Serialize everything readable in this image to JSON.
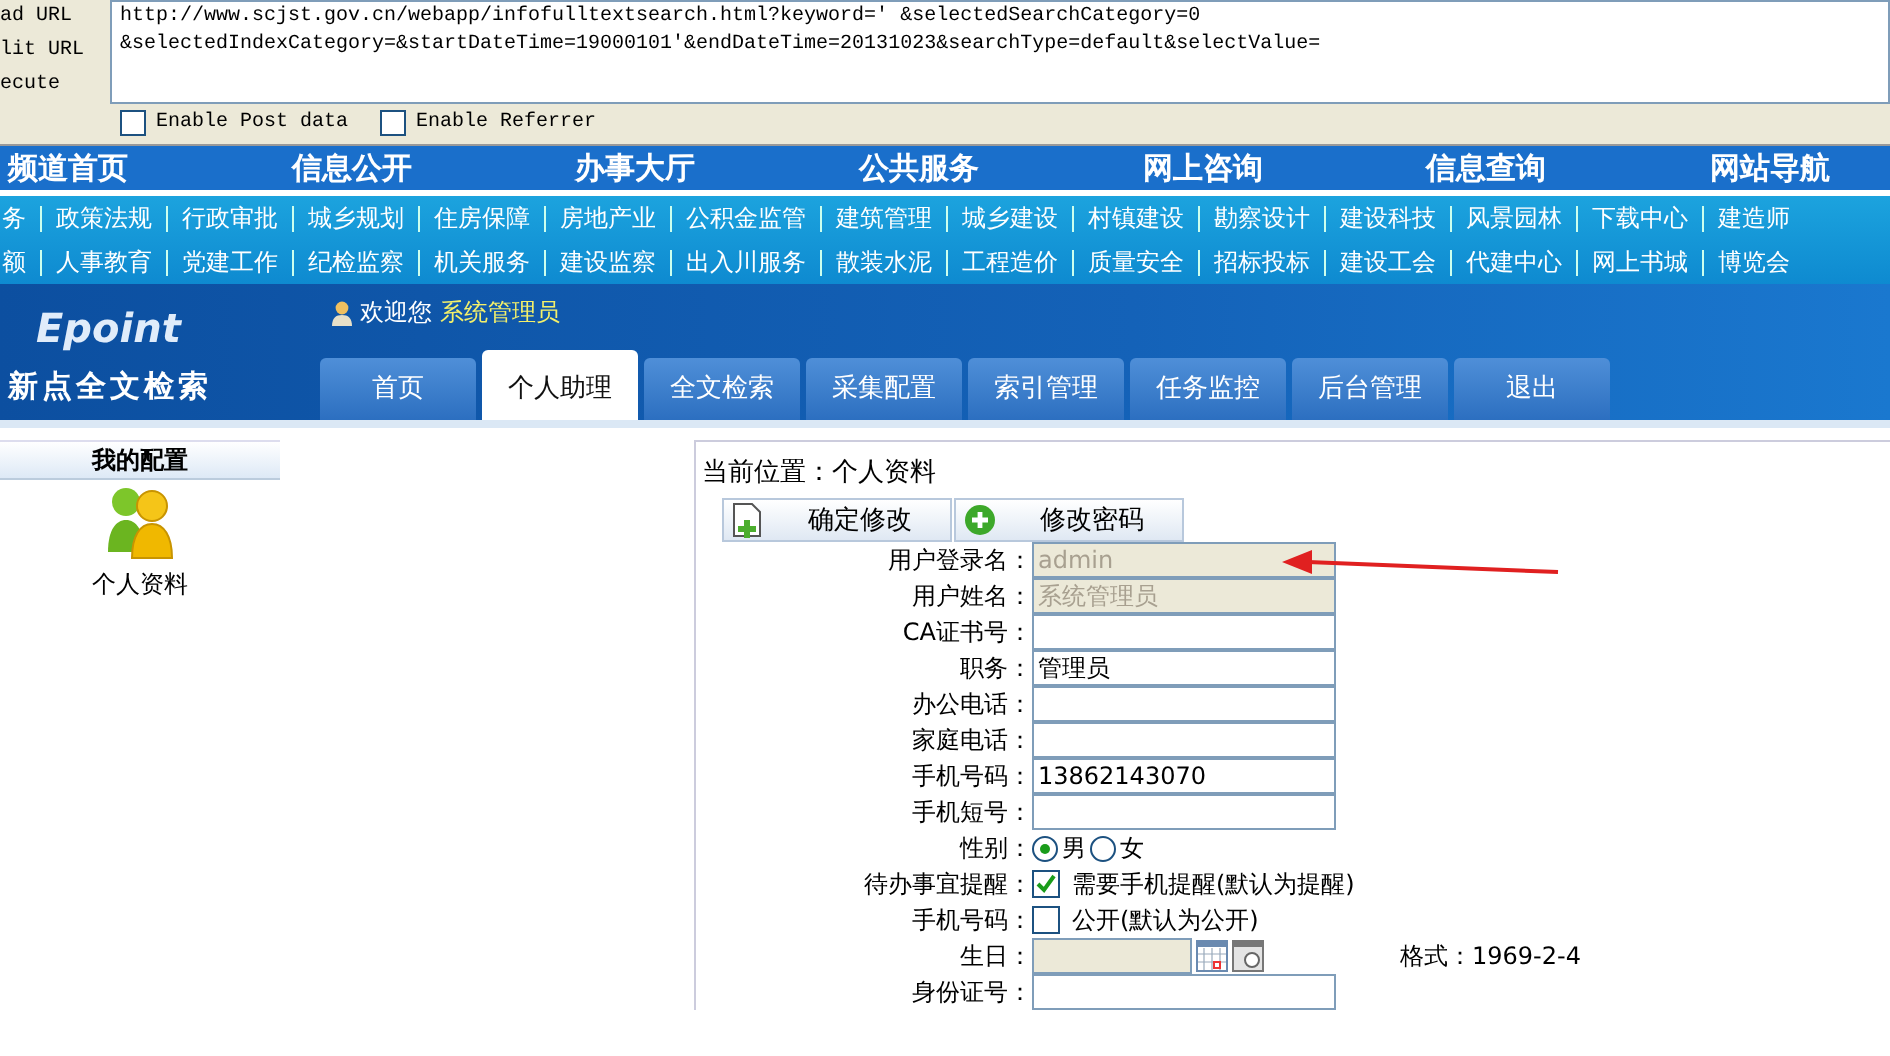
{
  "hackbar": {
    "labels": [
      "ad URL",
      "lit URL",
      "ecute"
    ],
    "url_lines": [
      "http://www.scjst.gov.cn/webapp/infofulltextsearch.html?keyword=' &selectedSearchCategory=0",
      "&selectedIndexCategory=&startDateTime=19000101'&endDateTime=20131023&searchType=default&selectValue="
    ],
    "options": [
      {
        "label": "Enable Post data",
        "checked": false
      },
      {
        "label": "Enable Referrer",
        "checked": false
      }
    ]
  },
  "main_nav": [
    "频道首页",
    "信息公开",
    "办事大厅",
    "公共服务",
    "网上咨询",
    "信息查询",
    "网站导航"
  ],
  "link_rows": [
    [
      "务",
      "政策法规",
      "行政审批",
      "城乡规划",
      "住房保障",
      "房地产业",
      "公积金监管",
      "建筑管理",
      "城乡建设",
      "村镇建设",
      "勘察设计",
      "建设科技",
      "风景园林",
      "下载中心",
      "建造师"
    ],
    [
      "额",
      "人事教育",
      "党建工作",
      "纪检监察",
      "机关服务",
      "建设监察",
      "出入川服务",
      "散装水泥",
      "工程造价",
      "质量安全",
      "招标投标",
      "建设工会",
      "代建中心",
      "网上书城",
      "博览会"
    ]
  ],
  "header": {
    "logo": "Epoint",
    "app_name": "新点全文检索",
    "welcome": "欢迎您",
    "user": "系统管理员"
  },
  "tabs": [
    {
      "label": "首页",
      "selected": false
    },
    {
      "label": "个人助理",
      "selected": true
    },
    {
      "label": "全文检索",
      "selected": false
    },
    {
      "label": "采集配置",
      "selected": false
    },
    {
      "label": "索引管理",
      "selected": false
    },
    {
      "label": "任务监控",
      "selected": false
    },
    {
      "label": "后台管理",
      "selected": false
    },
    {
      "label": "退出",
      "selected": false
    }
  ],
  "sidebar": {
    "title": "我的配置",
    "items": [
      {
        "label": "个人资料"
      }
    ]
  },
  "breadcrumb": "当前位置：个人资料",
  "buttons": [
    {
      "label": "确定修改",
      "kind": "doc"
    },
    {
      "label": "修改密码",
      "kind": "plus"
    }
  ],
  "form": [
    {
      "label": "用户登录名：",
      "kind": "text",
      "value": "admin",
      "disabled": true
    },
    {
      "label": "用户姓名：",
      "kind": "text",
      "value": "系统管理员",
      "disabled": true
    },
    {
      "label": "CA证书号：",
      "kind": "text",
      "disabled": false
    },
    {
      "label": "职务：",
      "kind": "text",
      "value": "管理员",
      "disabled": false
    },
    {
      "label": "办公电话：",
      "kind": "text",
      "disabled": false
    },
    {
      "label": "家庭电话：",
      "kind": "text",
      "disabled": false
    },
    {
      "label": "手机号码：",
      "kind": "text",
      "value": "13862143070",
      "disabled": false
    },
    {
      "label": "手机短号：",
      "kind": "text",
      "disabled": false
    },
    {
      "label": "性别：",
      "kind": "radio",
      "options": [
        {
          "label": "男",
          "selected": true
        },
        {
          "label": "女",
          "selected": false
        }
      ]
    },
    {
      "label": "待办事宜提醒：",
      "kind": "checkbox",
      "checked": true,
      "text": "需要手机提醒(默认为提醒)"
    },
    {
      "label": "手机号码：",
      "kind": "checkbox",
      "checked": false,
      "text": "公开(默认为公开)"
    },
    {
      "label": "生日：",
      "kind": "date",
      "hint": "格式：1969-2-4"
    },
    {
      "label": "身份证号：",
      "kind": "text",
      "disabled": false
    }
  ]
}
